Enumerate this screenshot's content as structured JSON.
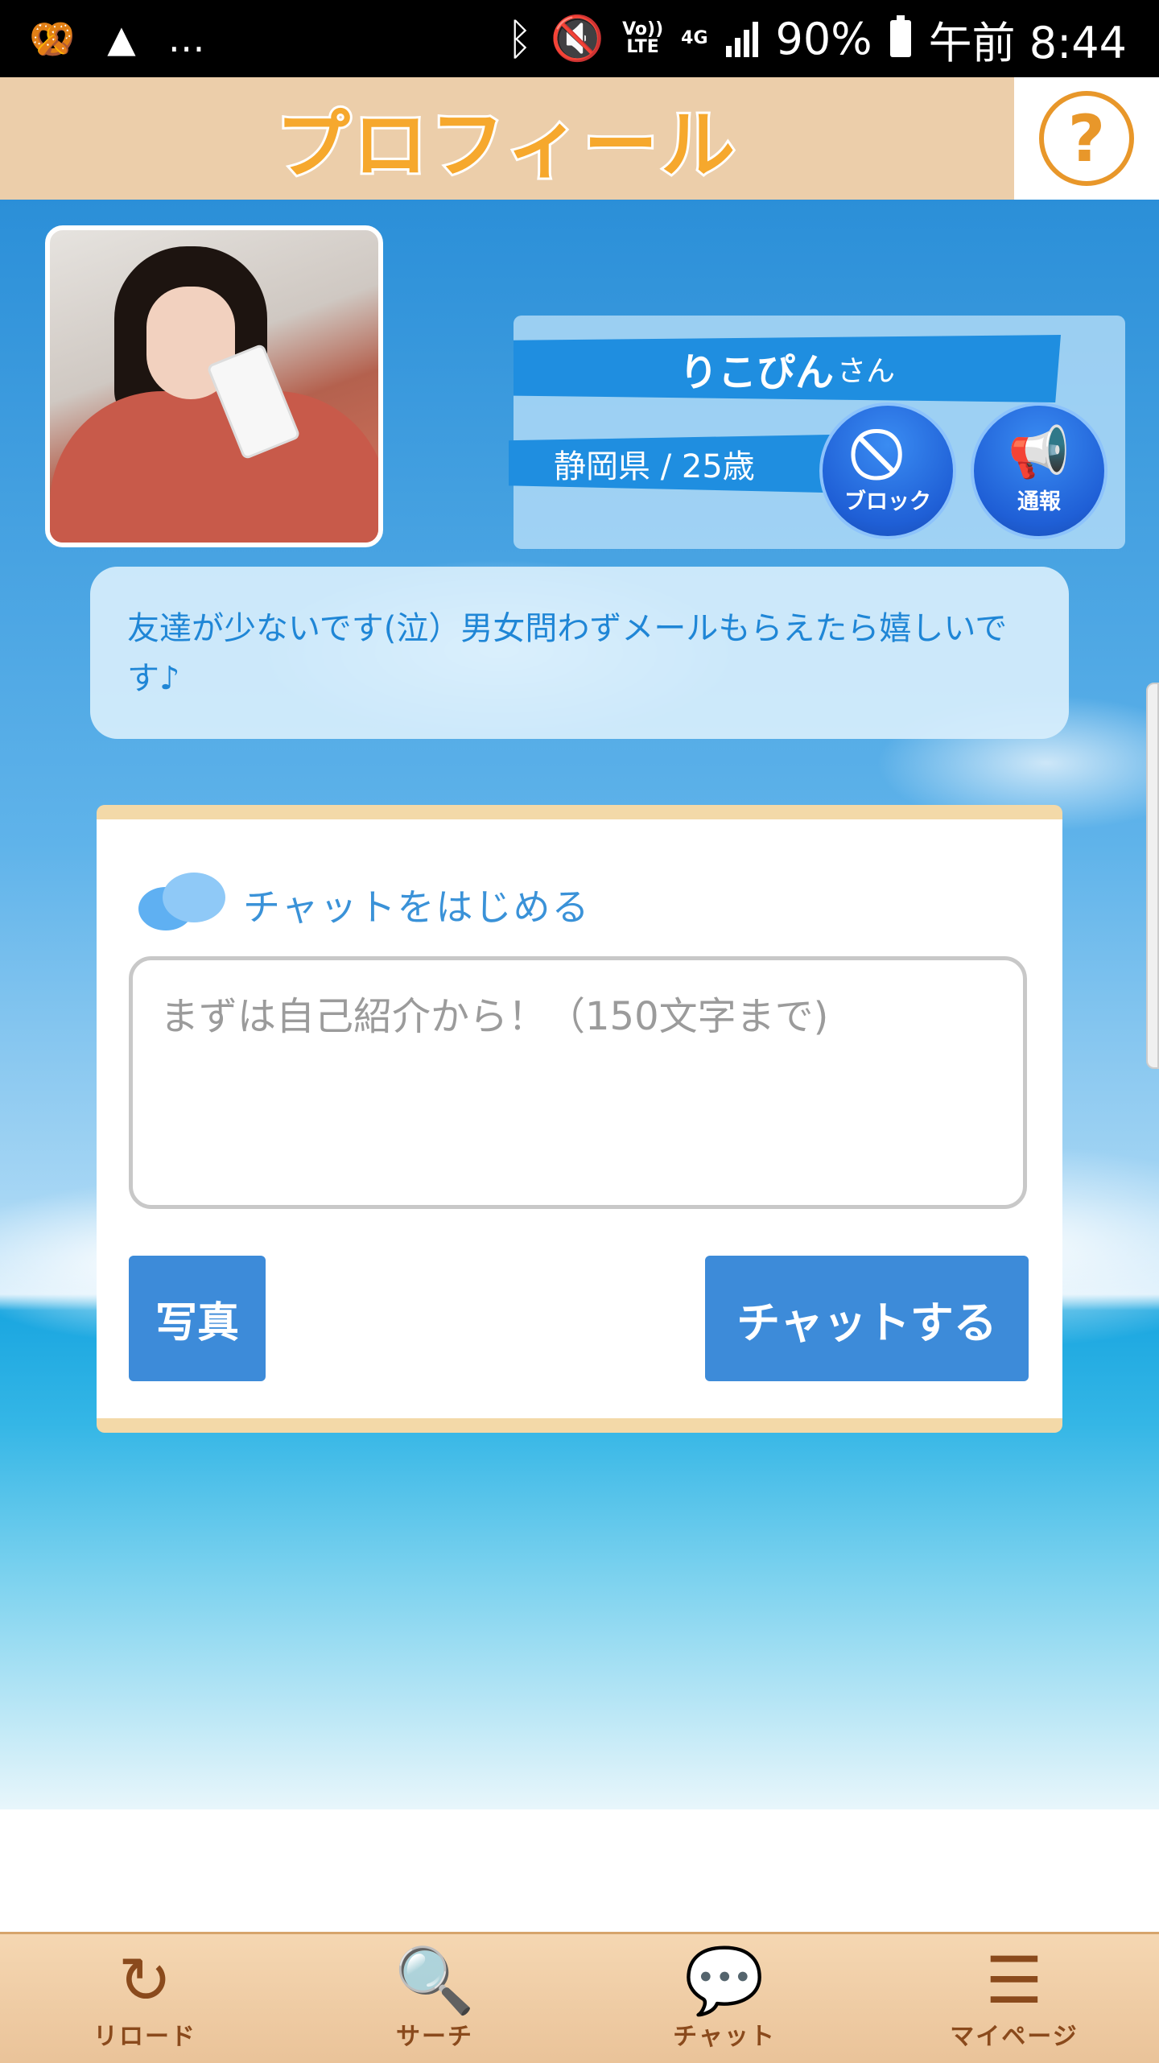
{
  "status_bar": {
    "left_icons": [
      "pretzel-icon",
      "keyhole-icon"
    ],
    "more": "…",
    "network_volte": "Vo))",
    "network_lte": "LTE",
    "network_4g": "4G",
    "battery": "90%",
    "time": "午前 8:44"
  },
  "header": {
    "title": "プロフィール",
    "help_label": "?"
  },
  "profile": {
    "name": "りこぴん",
    "name_suffix": "さん",
    "location_age": "静岡県 / 25歳",
    "block_label": "ブロック",
    "report_label": "通報",
    "bio": "友達が少ないです(泣）男女問わずメールもらえたら嬉しいです♪"
  },
  "chat": {
    "title": "チャットをはじめる",
    "placeholder": "まずは自己紹介から！（150文字まで)",
    "value": "",
    "photo_button": "写真",
    "send_button": "チャットする"
  },
  "bottom_nav": {
    "items": [
      {
        "label": "リロード",
        "icon": "reload-icon"
      },
      {
        "label": "サーチ",
        "icon": "search-icon"
      },
      {
        "label": "チャット",
        "icon": "chat-icon"
      },
      {
        "label": "マイページ",
        "icon": "menu-icon"
      }
    ]
  },
  "colors": {
    "header_bg": "#ecceaa",
    "title_orange": "#f6a82d",
    "primary_blue": "#3d8bd9",
    "strip_blue": "#1f8ee0",
    "nav_brown": "#8a4a1c"
  }
}
